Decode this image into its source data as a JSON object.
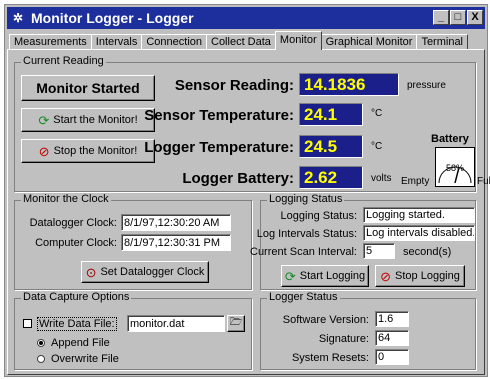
{
  "window": {
    "title": "Monitor Logger - Logger",
    "min": "_",
    "max": "□",
    "close": "X"
  },
  "tabs": [
    "Measurements",
    "Intervals",
    "Connection",
    "Collect Data",
    "Monitor",
    "Graphical Monitor",
    "Terminal"
  ],
  "active_tab": "Monitor",
  "current_reading": {
    "legend": "Current Reading",
    "status_button": "Monitor Started",
    "start_button": "Start the Monitor!",
    "stop_button": "Stop the Monitor!",
    "sensor_reading_label": "Sensor Reading:",
    "sensor_reading_value": "14.1836",
    "sensor_reading_unit": "pressure",
    "sensor_temp_label": "Sensor Temperature:",
    "sensor_temp_value": "24.1",
    "sensor_temp_unit": "°C",
    "logger_temp_label": "Logger Temperature:",
    "logger_temp_value": "24.5",
    "logger_temp_unit": "°C",
    "logger_battery_label": "Logger Battery:",
    "logger_battery_value": "2.62",
    "logger_battery_unit": "volts",
    "battery_gauge": {
      "title": "Battery",
      "percent_label": "58%",
      "fraction": 0.58,
      "empty": "Empty",
      "full": "Full"
    }
  },
  "clock": {
    "legend": "Monitor the Clock",
    "datalogger_label": "Datalogger Clock:",
    "datalogger_value": "8/1/97,12:30:20 AM",
    "computer_label": "Computer Clock:",
    "computer_value": "8/1/97,12:30:31 PM",
    "set_button": "Set Datalogger Clock"
  },
  "logging_status": {
    "legend": "Logging Status",
    "status_label": "Logging Status:",
    "status_value": "Logging started.",
    "intervals_label": "Log Intervals Status:",
    "intervals_value": "Log intervals disabled.",
    "scan_label": "Current Scan Interval:",
    "scan_value": "5",
    "scan_unit": "second(s)",
    "start_button": "Start Logging",
    "stop_button": "Stop Logging"
  },
  "data_capture": {
    "legend": "Data Capture Options",
    "write_label": "Write Data File:",
    "file_value": "monitor.dat",
    "append_label": "Append File",
    "overwrite_label": "Overwrite File"
  },
  "logger_status": {
    "legend": "Logger Status",
    "software_label": "Software Version:",
    "software_value": "1.6",
    "signature_label": "Signature:",
    "signature_value": "64",
    "resets_label": "System Resets:",
    "resets_value": "0"
  },
  "colors": {
    "title_bar": "#1c2f9c",
    "value_bg": "#1a1f8a",
    "value_fg": "#ffff00",
    "face": "#c0c0c0"
  }
}
